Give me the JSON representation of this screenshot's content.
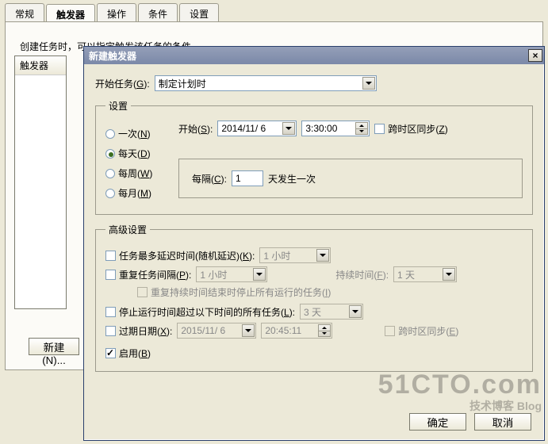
{
  "bg": {
    "tabs": [
      "常规",
      "触发器",
      "操作",
      "条件",
      "设置"
    ],
    "hint": "创建任务时，可以指定触发该任务的条件",
    "list_head": "触发器",
    "new_btn": "新建(N)..."
  },
  "dialog": {
    "title": "新建触发器",
    "begin_label": "开始任务(G):",
    "begin_value": "制定计划时",
    "settings_legend": "设置",
    "freq": {
      "once": "一次(N)",
      "daily": "每天(D)",
      "weekly": "每周(W)",
      "monthly": "每月(M)"
    },
    "start_label": "开始(S):",
    "start_date": "2014/11/ 6",
    "start_time": "3:30:00",
    "sync_tz": "跨时区同步(Z)",
    "interval_label": "每隔(C):",
    "interval_value": "1",
    "interval_suffix": "天发生一次",
    "adv_legend": "高级设置",
    "delay_label": "任务最多延迟时间(随机延迟)(K):",
    "delay_value": "1 小时",
    "repeat_label": "重复任务间隔(P):",
    "repeat_value": "1 小时",
    "duration_label": "持续时间(F):",
    "duration_value": "1 天",
    "stop_all": "重复持续时间结束时停止所有运行的任务(I)",
    "stop_after_label": "停止运行时间超过以下时间的所有任务(L):",
    "stop_after_value": "3 天",
    "expire_label": "过期日期(X):",
    "expire_date": "2015/11/ 6",
    "expire_time": "20:45:11",
    "sync_tz2": "跨时区同步(E)",
    "enable": "启用(B)",
    "ok": "确定",
    "cancel": "取消"
  },
  "watermark": {
    "big": "51CTO.com",
    "sm": "技术博客  Blog"
  }
}
